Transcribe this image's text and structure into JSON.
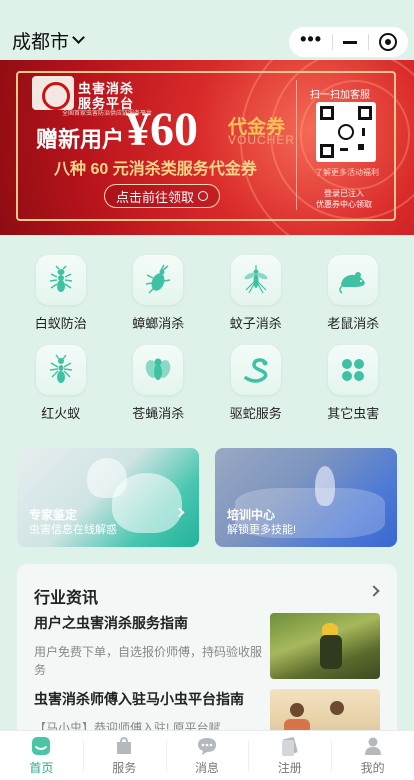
{
  "header": {
    "city": "成都市",
    "capsule_icons": [
      "more-dots-icon",
      "minimize-icon",
      "close-target-icon"
    ]
  },
  "banner": {
    "brand_line1": "虫害消杀",
    "brand_line2": "服务平台",
    "brand_sub": "全国首家虫害防治供应链服务平台",
    "headline": "赠新用户",
    "amount": "¥60",
    "voucher": "代金券",
    "voucher_en": "VOUCHER",
    "subline": "八种 60 元消杀类服务代金券",
    "cta": "点击前往领取",
    "scan_text": "扫一扫加客服",
    "more_text": "了解更多活动福利",
    "register_line1": "登录已注入",
    "register_line2": "优惠券中心领取",
    "colors": {
      "red": "#c8141c",
      "gold": "#f7c15a"
    }
  },
  "categories": [
    {
      "label": "白蚁防治",
      "icon": "termite-icon"
    },
    {
      "label": "蟑螂消杀",
      "icon": "cockroach-icon"
    },
    {
      "label": "蚊子消杀",
      "icon": "mosquito-icon"
    },
    {
      "label": "老鼠消杀",
      "icon": "rat-icon"
    },
    {
      "label": "红火蚁",
      "icon": "fire-ant-icon"
    },
    {
      "label": "苍蝇消杀",
      "icon": "fly-icon"
    },
    {
      "label": "驱蛇服务",
      "icon": "snake-icon"
    },
    {
      "label": "其它虫害",
      "icon": "clover-icon"
    }
  ],
  "promos": [
    {
      "title": "专家鉴定",
      "subtitle": "虫害信息在线解惑"
    },
    {
      "title": "培训中心",
      "subtitle": "解锁更多技能!"
    }
  ],
  "news": {
    "heading": "行业资讯",
    "items": [
      {
        "title": "用户之虫害消杀服务指南",
        "desc": "用户免费下单，自选报价师傅，持码验收服务"
      },
      {
        "title": "虫害消杀师傅入驻马小虫平台指南",
        "desc": "【马小虫】恭迎师傅入驻! 原平台赋"
      }
    ]
  },
  "tabbar": [
    {
      "label": "首页",
      "icon": "home-icon",
      "active": true
    },
    {
      "label": "服务",
      "icon": "service-bag-icon",
      "active": false
    },
    {
      "label": "消息",
      "icon": "message-bubble-icon",
      "active": false
    },
    {
      "label": "注册",
      "icon": "register-card-icon",
      "active": false
    },
    {
      "label": "我的",
      "icon": "user-profile-icon",
      "active": false
    }
  ],
  "accent": "#2aaa8a"
}
